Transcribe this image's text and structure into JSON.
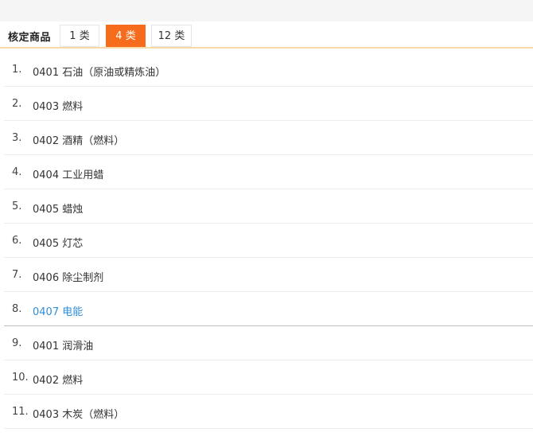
{
  "header": {
    "title": "核定商品",
    "tabs": [
      {
        "label": "1 类",
        "active": false
      },
      {
        "label": "4 类",
        "active": true
      },
      {
        "label": "12 类",
        "active": false
      }
    ]
  },
  "items": [
    {
      "num": "1.",
      "text": "0401 石油（原油或精炼油）"
    },
    {
      "num": "2.",
      "text": "0403 燃料"
    },
    {
      "num": "3.",
      "text": "0402 酒精（燃料）"
    },
    {
      "num": "4.",
      "text": "0404 工业用蜡"
    },
    {
      "num": "5.",
      "text": "0405 蜡烛"
    },
    {
      "num": "6.",
      "text": "0405 灯芯"
    },
    {
      "num": "7.",
      "text": "0406 除尘制剂"
    },
    {
      "num": "8.",
      "text": "0407 电能"
    },
    {
      "num": "9.",
      "text": "0401 润滑油"
    },
    {
      "num": "10.",
      "text": "0402 燃料"
    },
    {
      "num": "11.",
      "text": "0403 木炭（燃料）"
    }
  ],
  "colors": {
    "accent": "#f76b1c",
    "link": "#2f8ed8",
    "tab_underline": "#f7d9a6"
  }
}
